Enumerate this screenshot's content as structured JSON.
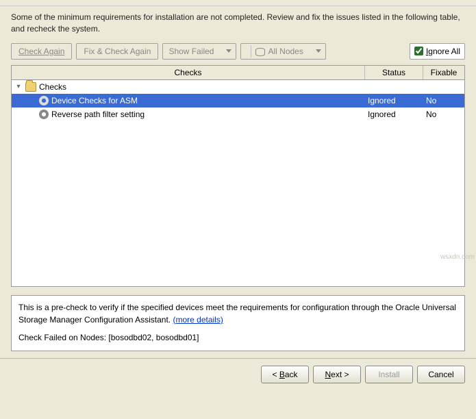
{
  "intro": "Some of the minimum requirements for installation are not completed. Review and fix the issues listed in the following table, and recheck the system.",
  "toolbar": {
    "check_again": "Check Again",
    "fix_check_again": "Fix & Check Again",
    "show_failed": "Show Failed",
    "all_nodes": "All Nodes",
    "ignore_all": "Ignore All",
    "ignore_all_checked": true
  },
  "table": {
    "headers": {
      "checks": "Checks",
      "status": "Status",
      "fixable": "Fixable"
    },
    "root": {
      "label": "Checks"
    },
    "rows": [
      {
        "label": "Device Checks for ASM",
        "status": "Ignored",
        "fixable": "No",
        "selected": true
      },
      {
        "label": "Reverse path filter setting",
        "status": "Ignored",
        "fixable": "No",
        "selected": false
      }
    ]
  },
  "details": {
    "text_prefix": "This is a pre-check to verify if the specified devices meet the requirements for configuration through the Oracle Universal Storage Manager Configuration Assistant. ",
    "more_details": "(more details)",
    "failed_nodes": "Check Failed on Nodes: [bosodbd02, bosodbd01]"
  },
  "footer": {
    "back": "Back",
    "next": "Next",
    "install": "Install",
    "cancel": "Cancel"
  },
  "watermark": "wsxdn.com"
}
